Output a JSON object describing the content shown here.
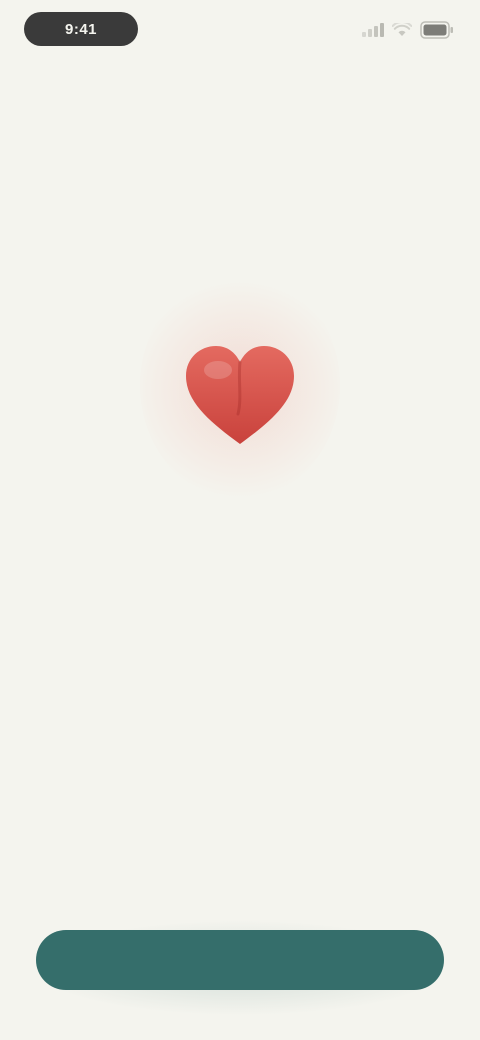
{
  "status_bar": {
    "time": "9:41",
    "icons": [
      "cellular-signal-icon",
      "wifi-icon",
      "battery-icon"
    ]
  },
  "hero": {
    "icon": "heart-icon",
    "accent_color": "#d9534f"
  },
  "headline": "",
  "body": "",
  "cta": {
    "label": "",
    "color": "#356e6b"
  }
}
